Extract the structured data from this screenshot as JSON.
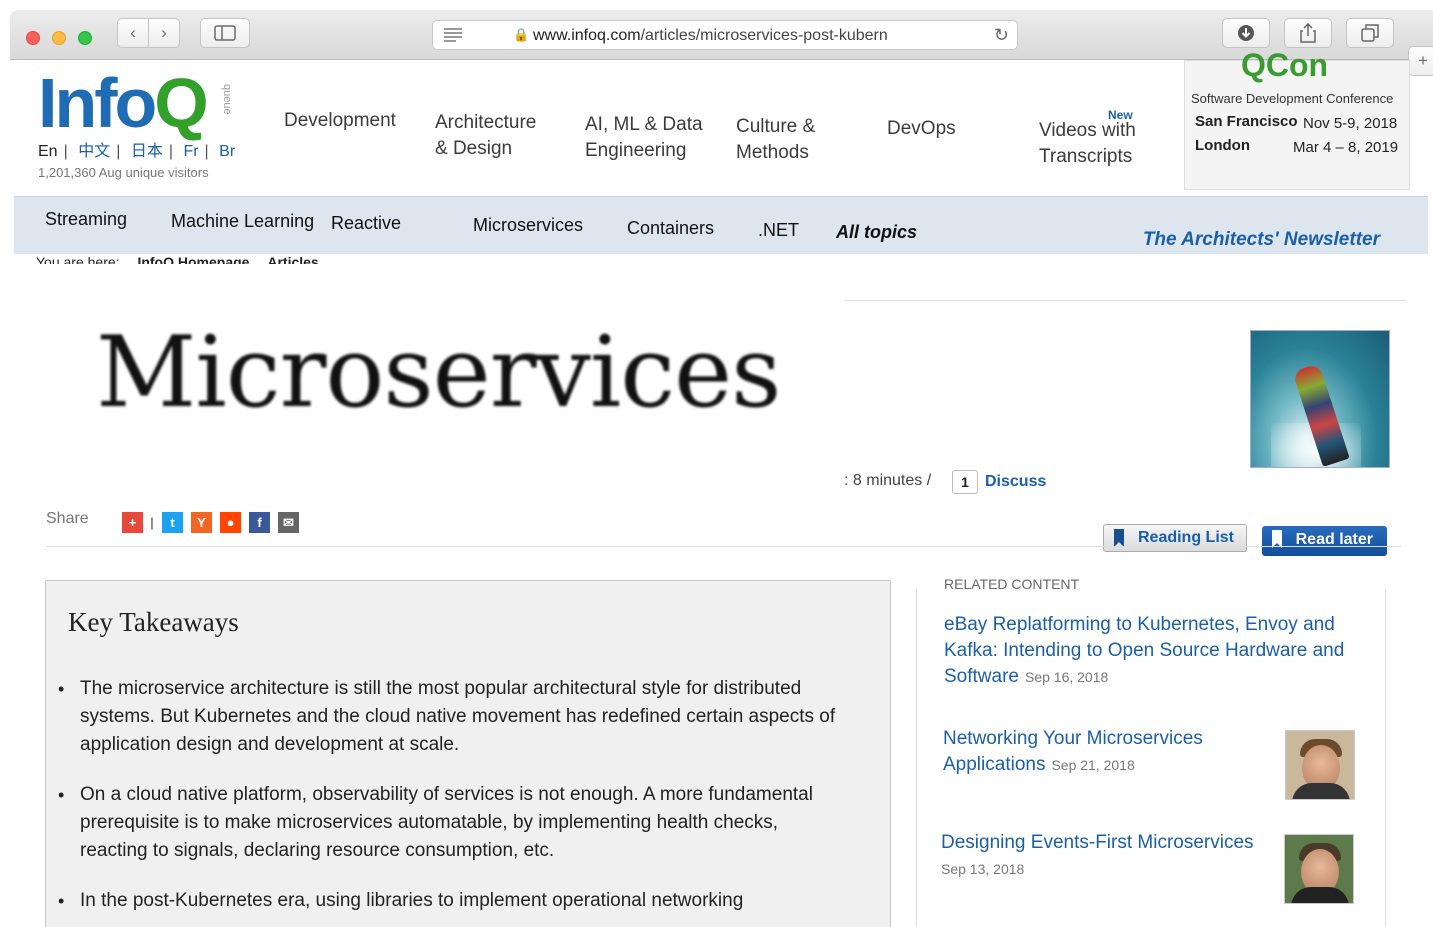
{
  "browser": {
    "url_domain": "www.infoq.com",
    "url_path": "/articles/microservices-post-kubern",
    "icons": [
      "back-icon",
      "forward-icon",
      "sidebar-icon",
      "reader-icon",
      "lock-icon",
      "reload-icon",
      "download-icon",
      "share-icon",
      "tabs-icon",
      "new-tab-icon"
    ]
  },
  "header": {
    "logo_info": "Info",
    "logo_q": "Q",
    "logo_tag": "queue",
    "languages": [
      "En",
      "中文",
      "日本",
      "Fr",
      "Br"
    ],
    "visitors": "1,201,360 Aug unique visitors",
    "nav": [
      {
        "line1": "Development",
        "line2": ""
      },
      {
        "line1": "Architecture",
        "line2": "& Design"
      },
      {
        "line1": "AI, ML & Data",
        "line2": "Engineering"
      },
      {
        "line1": "Culture &",
        "line2": "Methods"
      },
      {
        "line1": "DevOps",
        "line2": ""
      },
      {
        "line1": "Videos with",
        "line2": "Transcripts",
        "badge": "New"
      }
    ],
    "qcon": {
      "logo": "QCon",
      "subtitle": "Software Development Conference",
      "events": [
        {
          "city": "San Francisco",
          "date": "Nov 5-9, 2018"
        },
        {
          "city": "London",
          "date": "Mar 4 – 8, 2019"
        }
      ]
    }
  },
  "topics": {
    "items": [
      "Streaming",
      "Machine Learning",
      "Reactive",
      "Microservices",
      "Containers",
      ".NET",
      "All topics"
    ],
    "newsletter": "The Architects' Newsletter"
  },
  "breadcrumb": {
    "label": "You are here:",
    "items": [
      "InfoQ Homepage",
      "Articles"
    ]
  },
  "article": {
    "hero_word": "Microservices",
    "read_time": ": 8 minutes /",
    "discuss_count": "1",
    "discuss_label": "Discuss",
    "share_label": "Share",
    "reading_list": "Reading List",
    "read_later": "Read later"
  },
  "takeaways": {
    "title": "Key Takeaways",
    "items": [
      "The microservice architecture is still the most popular architectural style for distributed systems. But Kubernetes and the cloud native movement has redefined certain aspects of application design and development at scale.",
      "On a cloud native platform, observability of services is not enough. A more fundamental prerequisite is to make microservices automatable, by implementing health checks, reacting to signals, declaring resource consumption, etc.",
      "In the post-Kubernetes era, using libraries to implement operational networking"
    ]
  },
  "related": {
    "title": "RELATED CONTENT",
    "items": [
      {
        "title": "eBay Replatforming to Kubernetes, Envoy and Kafka: Intending to Open Source Hardware and Software",
        "date": "Sep 16, 2018"
      },
      {
        "title": "Networking Your Microservices Applications",
        "date": "Sep 21, 2018"
      },
      {
        "title": "Designing Events-First Microservices",
        "date": "Sep 13, 2018"
      }
    ]
  }
}
